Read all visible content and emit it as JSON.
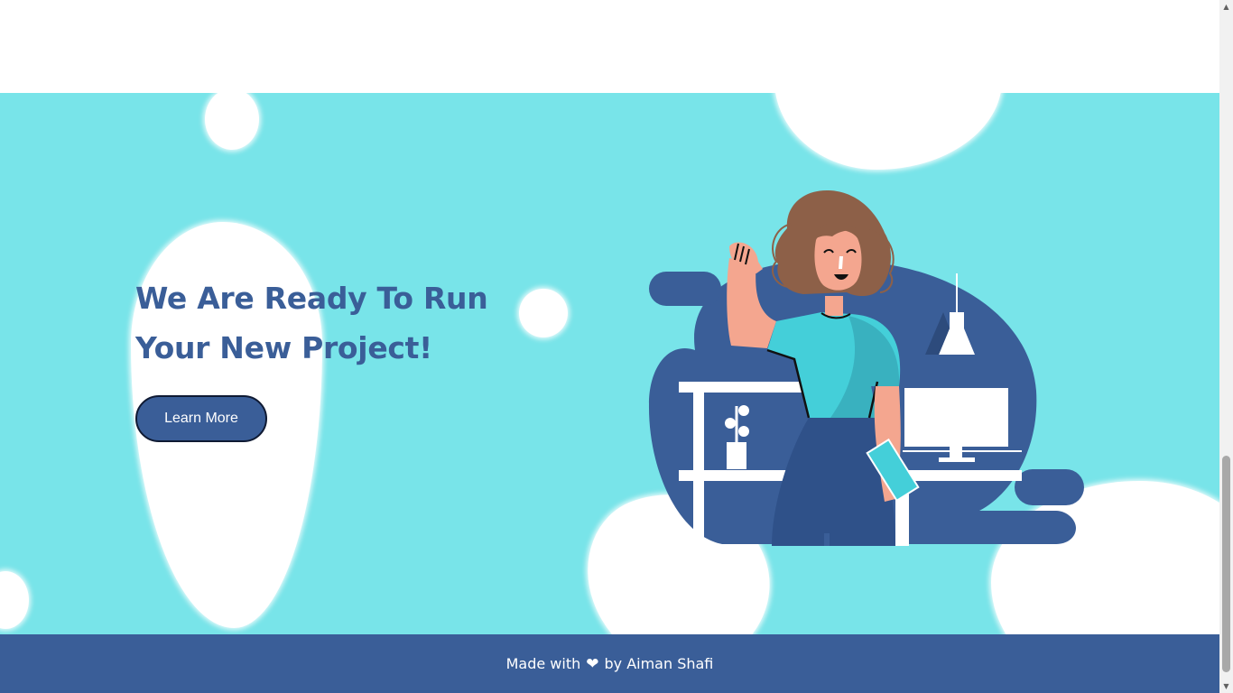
{
  "hero": {
    "title_line1": "We Are Ready To Run",
    "title_line2": "Your New Project!",
    "cta_label": "Learn More"
  },
  "footer": {
    "text_before": "Made with",
    "heart_icon": "heart-icon",
    "heart_glyph": "❤",
    "text_after": "by Aiman Shafi"
  },
  "scrollbar": {
    "up_arrow": "▲",
    "down_arrow": "▼"
  },
  "colors": {
    "hero_background": "#78e4e9",
    "brand_blue": "#3a5e98",
    "skin": "#f4a68f",
    "hair": "#8d6048",
    "shirt": "#44cfd9"
  }
}
